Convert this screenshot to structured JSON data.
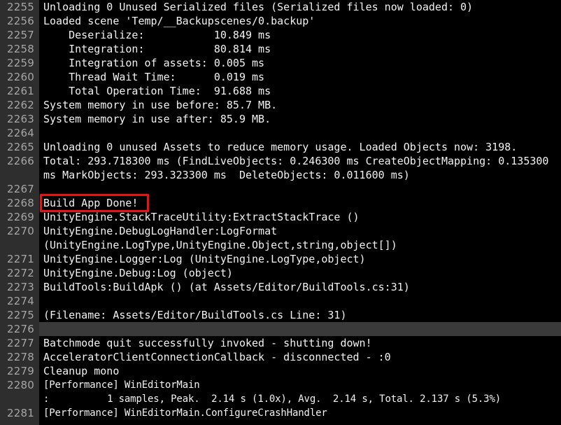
{
  "console": {
    "name": "unity-build-log-console",
    "background_color": "#000000",
    "gutter_color": "#2e2e2e",
    "text_color": "#f2f2f2",
    "gutter_text_color": "#a6a6a6",
    "selected_row_color": "#3a3a3a",
    "annotation_color": "#e81313",
    "annotation_target": "Build App Done!"
  },
  "lines": [
    {
      "number": "2255",
      "text": "Unloading 0 Unused Serialized files (Serialized files now loaded: 0)",
      "wrap": "",
      "selected": false,
      "blank": false,
      "condensed": false
    },
    {
      "number": "2256",
      "text": "Loaded scene 'Temp/__Backupscenes/0.backup'",
      "wrap": "",
      "selected": false,
      "blank": false,
      "condensed": false
    },
    {
      "number": "2257",
      "text": "    Deserialize:           10.849 ms",
      "wrap": "",
      "selected": false,
      "blank": false,
      "condensed": false
    },
    {
      "number": "2258",
      "text": "    Integration:           80.814 ms",
      "wrap": "",
      "selected": false,
      "blank": false,
      "condensed": false
    },
    {
      "number": "2259",
      "text": "    Integration of assets: 0.005 ms",
      "wrap": "",
      "selected": false,
      "blank": false,
      "condensed": false
    },
    {
      "number": "2260",
      "text": "    Thread Wait Time:      0.019 ms",
      "wrap": "",
      "selected": false,
      "blank": false,
      "condensed": false
    },
    {
      "number": "2261",
      "text": "    Total Operation Time:  91.688 ms",
      "wrap": "",
      "selected": false,
      "blank": false,
      "condensed": false
    },
    {
      "number": "2262",
      "text": "System memory in use before: 85.7 MB.",
      "wrap": "",
      "selected": false,
      "blank": false,
      "condensed": false
    },
    {
      "number": "2263",
      "text": "System memory in use after: 85.9 MB.",
      "wrap": "",
      "selected": false,
      "blank": false,
      "condensed": false
    },
    {
      "number": "2264",
      "text": "",
      "wrap": "",
      "selected": false,
      "blank": true,
      "condensed": false
    },
    {
      "number": "2265",
      "text": "Unloading 0 unused Assets to reduce memory usage. Loaded Objects now: 3198.",
      "wrap": "",
      "selected": false,
      "blank": false,
      "condensed": false
    },
    {
      "number": "2266",
      "text": "Total: 293.718300 ms (FindLiveObjects: 0.246300 ms CreateObjectMapping: 0.135300",
      "wrap": "ms MarkObjects: 293.323300 ms  DeleteObjects: 0.011600 ms)",
      "selected": false,
      "blank": false,
      "condensed": false
    },
    {
      "number": "2267",
      "text": "",
      "wrap": "",
      "selected": false,
      "blank": true,
      "condensed": false
    },
    {
      "number": "2268",
      "text": "Build App Done!",
      "wrap": "",
      "selected": false,
      "blank": false,
      "condensed": false
    },
    {
      "number": "2269",
      "text": "UnityEngine.StackTraceUtility:ExtractStackTrace ()",
      "wrap": "",
      "selected": false,
      "blank": false,
      "condensed": false
    },
    {
      "number": "2270",
      "text": "UnityEngine.DebugLogHandler:LogFormat",
      "wrap": "(UnityEngine.LogType,UnityEngine.Object,string,object[])",
      "selected": false,
      "blank": false,
      "condensed": false
    },
    {
      "number": "2271",
      "text": "UnityEngine.Logger:Log (UnityEngine.LogType,object)",
      "wrap": "",
      "selected": false,
      "blank": false,
      "condensed": false
    },
    {
      "number": "2272",
      "text": "UnityEngine.Debug:Log (object)",
      "wrap": "",
      "selected": false,
      "blank": false,
      "condensed": false
    },
    {
      "number": "2273",
      "text": "BuildTools:BuildApk () (at Assets/Editor/BuildTools.cs:31)",
      "wrap": "",
      "selected": false,
      "blank": false,
      "condensed": false
    },
    {
      "number": "2274",
      "text": "",
      "wrap": "",
      "selected": false,
      "blank": true,
      "condensed": false
    },
    {
      "number": "2275",
      "text": "(Filename: Assets/Editor/BuildTools.cs Line: 31)",
      "wrap": "",
      "selected": false,
      "blank": false,
      "condensed": false
    },
    {
      "number": "2276",
      "text": "",
      "wrap": "",
      "selected": true,
      "blank": true,
      "condensed": false
    },
    {
      "number": "2277",
      "text": "Batchmode quit successfully invoked - shutting down!",
      "wrap": "",
      "selected": false,
      "blank": false,
      "condensed": false
    },
    {
      "number": "2278",
      "text": "AcceleratorClientConnectionCallback - disconnected - :0",
      "wrap": "",
      "selected": false,
      "blank": false,
      "condensed": false
    },
    {
      "number": "2279",
      "text": "Cleanup mono",
      "wrap": "",
      "selected": false,
      "blank": false,
      "condensed": false
    },
    {
      "number": "2280",
      "text": "[Performance] WinEditorMain",
      "wrap": ":          1 samples, Peak.  2.14 s (1.0x), Avg.  2.14 s, Total. 2.137 s (5.3%)",
      "selected": false,
      "blank": false,
      "condensed": true
    },
    {
      "number": "2281",
      "text": "[Performance] WinEditorMain.ConfigureCrashHandler",
      "wrap": "",
      "selected": false,
      "blank": false,
      "condensed": true
    }
  ]
}
